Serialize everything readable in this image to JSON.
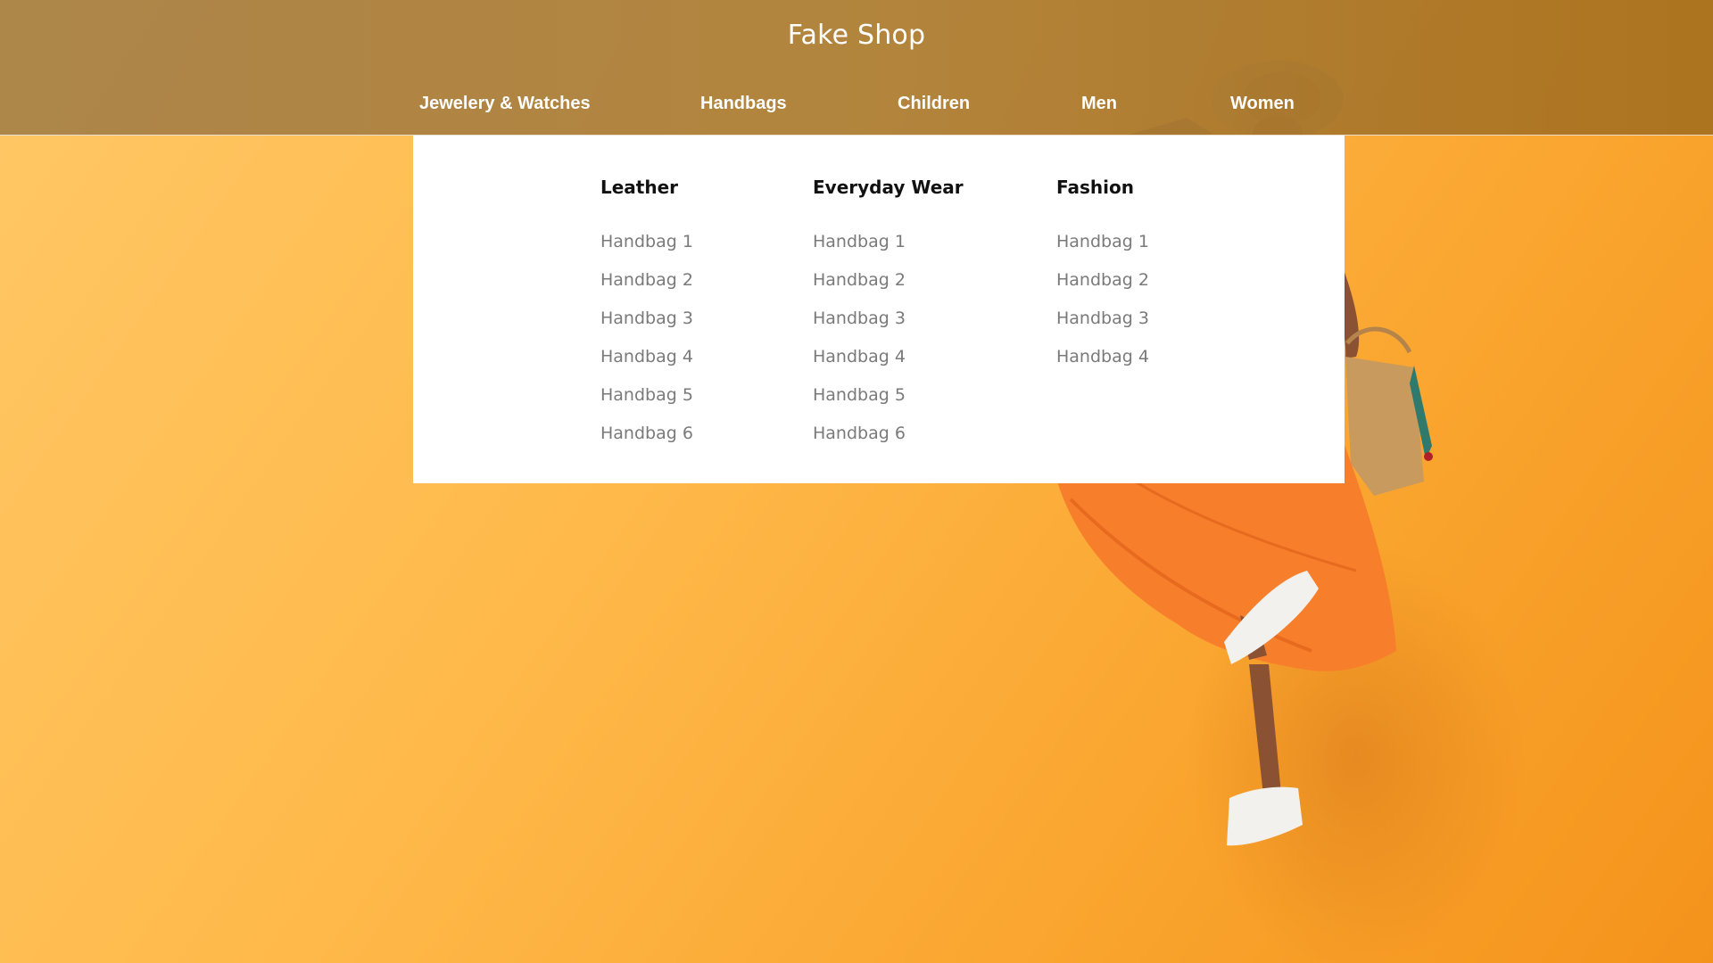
{
  "header": {
    "title": "Fake Shop",
    "nav": [
      {
        "label": "Jewelery & Watches"
      },
      {
        "label": "Handbags"
      },
      {
        "label": "Children"
      },
      {
        "label": "Men"
      },
      {
        "label": "Women"
      }
    ]
  },
  "mega_menu": {
    "columns": [
      {
        "heading": "Leather",
        "items": [
          "Handbag 1",
          "Handbag 2",
          "Handbag 3",
          "Handbag 4",
          "Handbag 5",
          "Handbag 6"
        ]
      },
      {
        "heading": "Everyday Wear",
        "items": [
          "Handbag 1",
          "Handbag 2",
          "Handbag 3",
          "Handbag 4",
          "Handbag 5",
          "Handbag 6"
        ]
      },
      {
        "heading": "Fashion",
        "items": [
          "Handbag 1",
          "Handbag 2",
          "Handbag 3",
          "Handbag 4"
        ]
      }
    ]
  },
  "colors": {
    "background": "#ffb94a",
    "header_bar": "#a8803c",
    "menu_link": "#7a7a7a",
    "dress": "#f77f2c"
  }
}
